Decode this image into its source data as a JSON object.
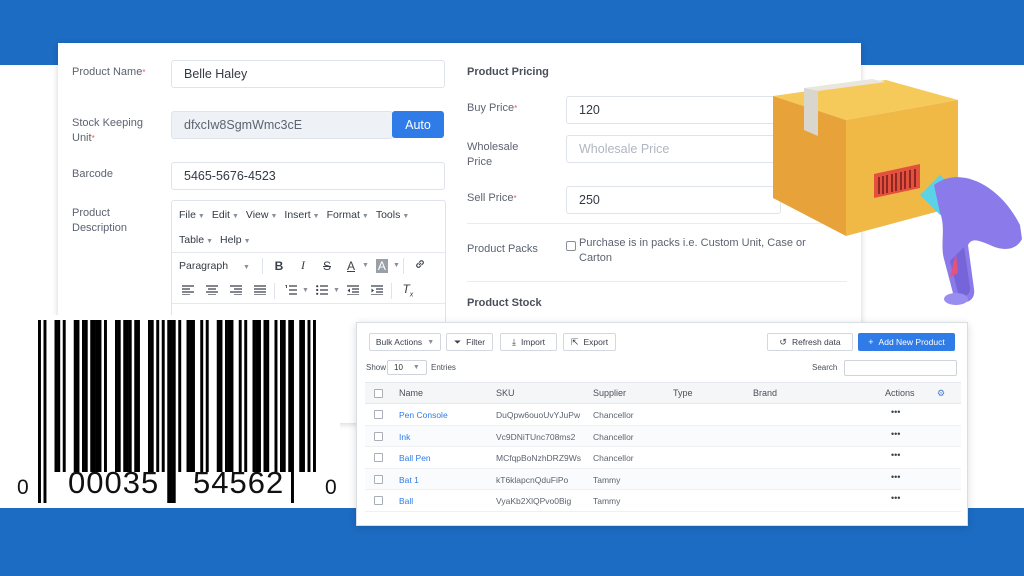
{
  "colors": {
    "brand_blue": "#1c6cc4",
    "accent": "#2f7be8",
    "required": "#e35d5d"
  },
  "form": {
    "product_name_label": "Product Name",
    "product_name_value": "Belle Haley",
    "sku_label": "Stock Keeping Unit",
    "sku_value": "dfxcIw8SgmWmc3cE",
    "auto_label": "Auto",
    "barcode_label": "Barcode",
    "barcode_value": "5465-5676-4523",
    "description_label": "Product Description",
    "editor": {
      "menus": [
        "File",
        "Edit",
        "View",
        "Insert",
        "Format",
        "Tools",
        "Table",
        "Help"
      ],
      "block_format": "Paragraph"
    }
  },
  "pricing": {
    "section_title": "Product Pricing",
    "buy_price_label": "Buy Price",
    "buy_price_value": "120",
    "wholesale_label": "Wholesale Price",
    "wholesale_placeholder": "Wholesale Price",
    "sell_price_label": "Sell Price",
    "sell_price_value": "250",
    "packs_label": "Product Packs",
    "packs_checkbox_text": "Purchase is in packs i.e. Custom Unit, Case or Carton",
    "stock_title": "Product Stock"
  },
  "barcode_graphic": {
    "lead_digit": "0",
    "left_group": "00035",
    "right_group": "54562",
    "check_digit": "0"
  },
  "table": {
    "toolbar": {
      "bulk_actions": "Bulk Actions",
      "filter": "Filter",
      "import": "Import",
      "export": "Export",
      "refresh": "Refresh data",
      "add_new": "Add New Product"
    },
    "show_label": "Show",
    "page_size": "10",
    "entries_label": "Entries",
    "search_label": "Search",
    "columns": [
      "Name",
      "SKU",
      "Supplier",
      "Type",
      "Brand",
      "Actions"
    ],
    "rows": [
      {
        "name": "Pen Console",
        "sku": "DuQpw6ouoUvYJuPw",
        "supplier": "Chancellor",
        "type": "",
        "brand": "",
        "actions": "•••"
      },
      {
        "name": "Ink",
        "sku": "Vc9DNiTUnc708ms2",
        "supplier": "Chancellor",
        "type": "",
        "brand": "",
        "actions": "•••"
      },
      {
        "name": "Ball Pen",
        "sku": "MCfqpBoNzhDRZ9Ws",
        "supplier": "Chancellor",
        "type": "",
        "brand": "",
        "actions": "•••"
      },
      {
        "name": "Bat 1",
        "sku": "kT6klapcnQduFiPo",
        "supplier": "Tammy",
        "type": "",
        "brand": "",
        "actions": "•••"
      },
      {
        "name": "Ball",
        "sku": "VyaKb2XlQPvo0Big",
        "supplier": "Tammy",
        "type": "",
        "brand": "",
        "actions": "•••"
      }
    ]
  }
}
